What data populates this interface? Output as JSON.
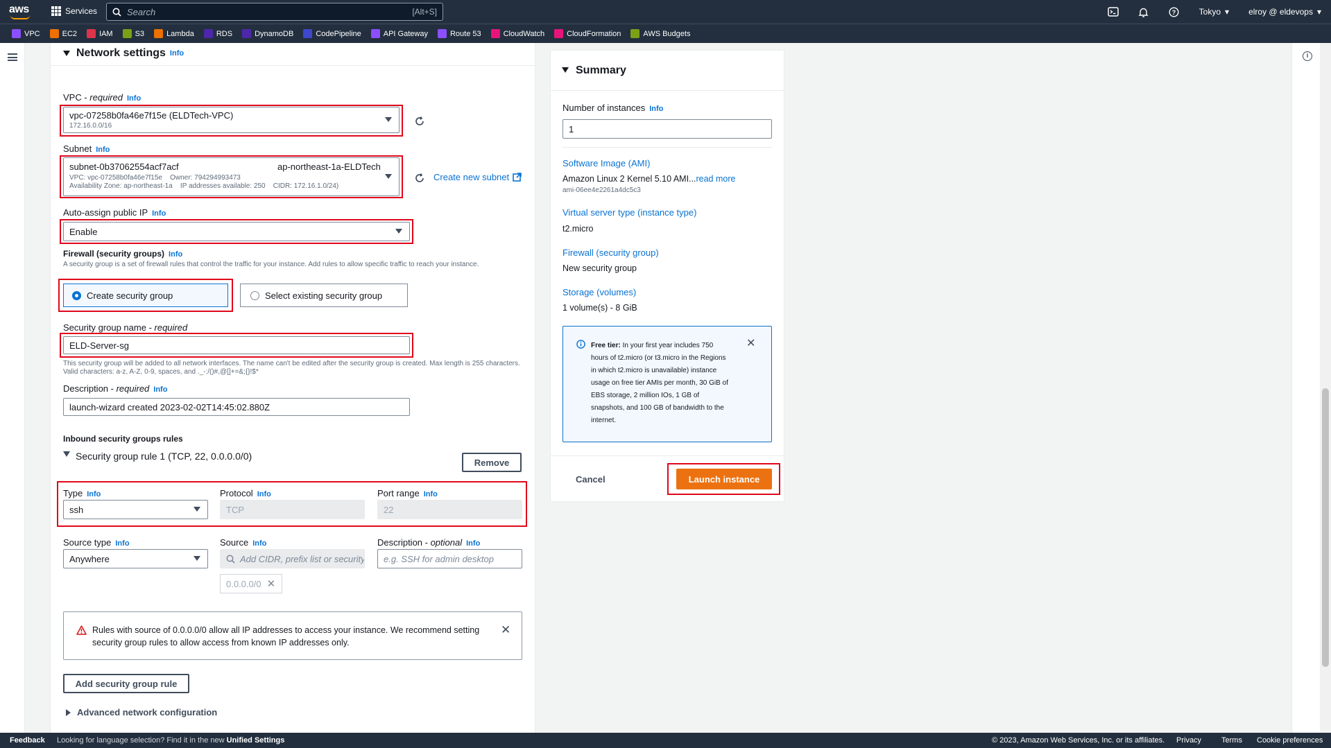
{
  "topnav": {
    "logo": "aws",
    "services_label": "Services",
    "search_placeholder": "Search",
    "search_shortcut": "[Alt+S]",
    "region": "Tokyo",
    "account": "elroy @ eldevops"
  },
  "favorites": [
    {
      "label": "VPC",
      "color": "#8c4fff"
    },
    {
      "label": "EC2",
      "color": "#ed7100"
    },
    {
      "label": "IAM",
      "color": "#dd344c"
    },
    {
      "label": "S3",
      "color": "#7aa116"
    },
    {
      "label": "Lambda",
      "color": "#ed7100"
    },
    {
      "label": "RDS",
      "color": "#4d27aa"
    },
    {
      "label": "DynamoDB",
      "color": "#4d27aa"
    },
    {
      "label": "CodePipeline",
      "color": "#3f48cc"
    },
    {
      "label": "API Gateway",
      "color": "#8c4fff"
    },
    {
      "label": "Route 53",
      "color": "#8c4fff"
    },
    {
      "label": "CloudWatch",
      "color": "#e7157b"
    },
    {
      "label": "CloudFormation",
      "color": "#e7157b"
    },
    {
      "label": "AWS Budgets",
      "color": "#7aa116"
    }
  ],
  "network": {
    "title": "Network settings",
    "info": "Info",
    "vpc_label": "VPC - ",
    "vpc_required": "required",
    "vpc_value": "vpc-07258b0fa46e7f15e (ELDTech-VPC)",
    "vpc_cidr": "172.16.0.0/16",
    "subnet_label": "Subnet",
    "subnet_id": "subnet-0b37062554acf7acf",
    "subnet_name": "ap-northeast-1a-ELDTech",
    "subnet_line2a": "VPC: vpc-07258b0fa46e7f15e",
    "subnet_line2b": "Owner: 794294993473",
    "subnet_line3a": "Availability Zone: ap-northeast-1a",
    "subnet_line3b": "IP addresses available: 250",
    "subnet_line3c": "CIDR: 172.16.1.0/24)",
    "create_subnet": "Create new subnet",
    "public_ip_label": "Auto-assign public IP",
    "public_ip_value": "Enable",
    "firewall_label": "Firewall (security groups)",
    "firewall_desc": "A security group is a set of firewall rules that control the traffic for your instance. Add rules to allow specific traffic to reach your instance.",
    "create_sg": "Create security group",
    "select_sg": "Select existing security group",
    "sg_name_label": "Security group name - ",
    "sg_name_required": "required",
    "sg_name_value": "ELD-Server-sg",
    "sg_name_help": "This security group will be added to all network interfaces. The name can't be edited after the security group is created. Max length is 255 characters. Valid characters: a-z, A-Z, 0-9, spaces, and ._-:/()#,@[]+=&;{}!$*",
    "desc_label": "Description - ",
    "desc_required": "required",
    "desc_value": "launch-wizard created 2023-02-02T14:45:02.880Z",
    "inbound_title": "Inbound security groups rules",
    "rule_title": "Security group rule 1 (TCP, 22, 0.0.0.0/0)",
    "remove": "Remove",
    "type_label": "Type",
    "type_value": "ssh",
    "protocol_label": "Protocol",
    "protocol_value": "TCP",
    "port_label": "Port range",
    "port_value": "22",
    "source_type_label": "Source type",
    "source_type_value": "Anywhere",
    "source_label": "Source",
    "source_placeholder": "Add CIDR, prefix list or security",
    "source_token": "0.0.0.0/0",
    "rdesc_label": "Description - ",
    "rdesc_optional": "optional",
    "rdesc_placeholder": "e.g. SSH for admin desktop",
    "warning": "Rules with source of 0.0.0.0/0 allow all IP addresses to access your instance. We recommend setting security group rules to allow access from known IP addresses only.",
    "add_rule": "Add security group rule",
    "advanced": "Advanced network configuration"
  },
  "summary": {
    "title": "Summary",
    "instances_label": "Number of instances",
    "instances_value": "1",
    "ami_label": "Software Image (AMI)",
    "ami_value": "Amazon Linux 2 Kernel 5.10 AMI...",
    "ami_more": "read more",
    "ami_id": "ami-06ee4e2261a4dc5c3",
    "type_label": "Virtual server type (instance type)",
    "type_value": "t2.micro",
    "fw_label": "Firewall (security group)",
    "fw_value": "New security group",
    "storage_label": "Storage (volumes)",
    "storage_value": "1 volume(s) - 8 GiB",
    "free_tier_bold": "Free tier:",
    "free_tier_text": "In your first year includes 750 hours of t2.micro (or t3.micro in the Regions in which t2.micro is unavailable) instance usage on free tier AMIs per month, 30 GiB of EBS storage, 2 million IOs, 1 GB of snapshots, and 100 GB of bandwidth to the internet.",
    "cancel": "Cancel",
    "launch": "Launch instance"
  },
  "footer": {
    "feedback": "Feedback",
    "lang_text": "Looking for language selection? Find it in the new",
    "lang_link": "Unified Settings",
    "copyright": "© 2023, Amazon Web Services, Inc. or its affiliates.",
    "privacy": "Privacy",
    "terms": "Terms",
    "cookies": "Cookie preferences"
  }
}
